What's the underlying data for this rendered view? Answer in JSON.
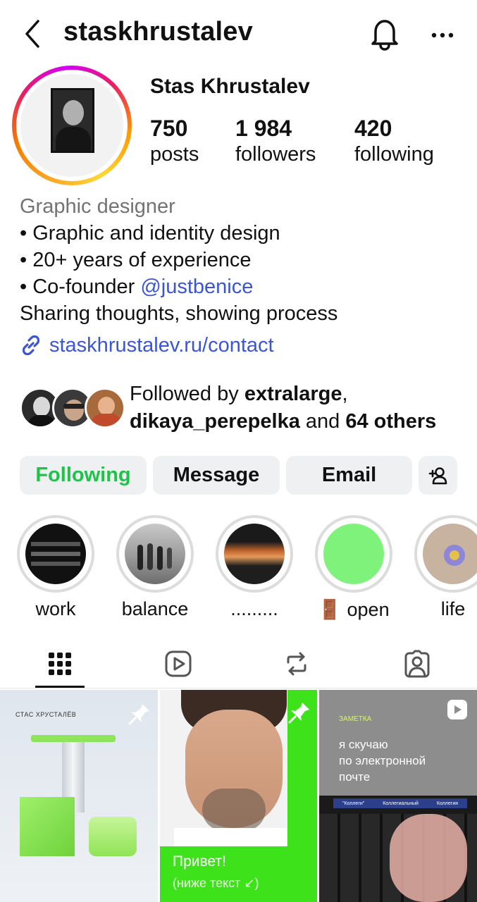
{
  "header": {
    "username": "staskhrustalev",
    "back_icon": "chevron-left-icon",
    "bell_icon": "bell-icon",
    "more_icon": "more-horizontal-icon"
  },
  "profile": {
    "display_name": "Stas Khrustalev",
    "stats": [
      {
        "value": "750",
        "label": "posts"
      },
      {
        "value": "1 984",
        "label": "followers"
      },
      {
        "value": "420",
        "label": "following"
      }
    ]
  },
  "bio": {
    "category": "Graphic designer",
    "line1": "• Graphic and identity design",
    "line2": "• 20+ years of experience",
    "line3_prefix": "• Co-founder ",
    "line3_mention": "@justbenice",
    "line4": "Sharing thoughts, showing process",
    "link": "staskhrustalev.ru/contact"
  },
  "followed_by": {
    "prefix": "Followed by ",
    "user1": "extralarge",
    "sep": ",",
    "user2": "dikaya_perepelka",
    "and": " and ",
    "others": "64 others"
  },
  "actions": {
    "following": "Following",
    "message": "Message",
    "email": "Email"
  },
  "highlights": [
    {
      "label": "work"
    },
    {
      "label": "balance"
    },
    {
      "label": "........."
    },
    {
      "label": "🚪 open"
    },
    {
      "label": "life"
    }
  ],
  "tabs": [
    "grid-icon",
    "reels-icon",
    "reposts-icon",
    "tagged-icon"
  ],
  "posts": {
    "post1_caption": "СТАС ХРУСТАЛЁВ",
    "post2_greeting": "Привет!",
    "post2_sub": "(ниже текст ↙)",
    "post3_tag": "ЗАМЕТКА",
    "post3_text_1": "я скучаю",
    "post3_text_2": "по электронной",
    "post3_text_3": "почте",
    "post3_kb1": "\"Коллеги\"",
    "post3_kb2": "Коллегиальный",
    "post3_kb3": "Коллегия"
  },
  "colors": {
    "accent_green": "#21c24a",
    "link_blue": "#3a55d6",
    "button_bg": "#eff0f2",
    "post_green": "#3ee21a"
  }
}
